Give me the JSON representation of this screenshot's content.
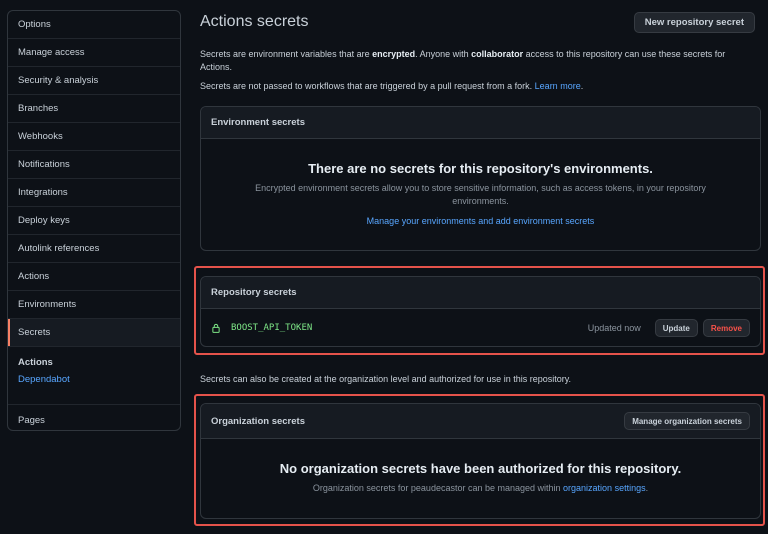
{
  "sidebar": {
    "items": [
      {
        "label": "Options"
      },
      {
        "label": "Manage access"
      },
      {
        "label": "Security & analysis"
      },
      {
        "label": "Branches"
      },
      {
        "label": "Webhooks"
      },
      {
        "label": "Notifications"
      },
      {
        "label": "Integrations"
      },
      {
        "label": "Deploy keys"
      },
      {
        "label": "Autolink references"
      },
      {
        "label": "Actions"
      },
      {
        "label": "Environments"
      },
      {
        "label": "Secrets",
        "active": true
      }
    ],
    "group": {
      "title": "Actions",
      "link": "Dependabot"
    },
    "last_item": "Pages"
  },
  "main": {
    "title": "Actions secrets",
    "new_secret_button": "New repository secret",
    "description": {
      "part1": "Secrets are environment variables that are ",
      "bold1": "encrypted",
      "part2": ". Anyone with ",
      "bold2": "collaborator",
      "part3": " access to this repository can use these secrets for Actions."
    },
    "fork_note": {
      "text": "Secrets are not passed to workflows that are triggered by a pull request from a fork. ",
      "link": "Learn more",
      "end": "."
    },
    "environment_secrets": {
      "header": "Environment secrets",
      "blank_title": "There are no secrets for this repository's environments.",
      "blank_text": "Encrypted environment secrets allow you to store sensitive information, such as access tokens, in your repository environments.",
      "link": "Manage your environments and add environment secrets"
    },
    "repository_secrets": {
      "header": "Repository secrets",
      "rows": [
        {
          "name": "BOOST_API_TOKEN",
          "updated": "Updated now",
          "update_label": "Update",
          "remove_label": "Remove"
        }
      ]
    },
    "org_note": "Secrets can also be created at the organization level and authorized for use in this repository.",
    "organization_secrets": {
      "header": "Organization secrets",
      "manage_button": "Manage organization secrets",
      "blank_title": "No organization secrets have been authorized for this repository.",
      "blank_text": "Organization secrets for peaudecastor can be managed within ",
      "blank_link": "organization settings",
      "blank_end": "."
    }
  },
  "colors": {
    "background": "#0d1117",
    "border": "#30363d",
    "link": "#58a6ff",
    "secret_name": "#7ee787",
    "danger": "#f85149",
    "highlight": "#e5534b",
    "active_indicator": "#f78166"
  },
  "icons": {
    "lock": "lock-icon"
  }
}
